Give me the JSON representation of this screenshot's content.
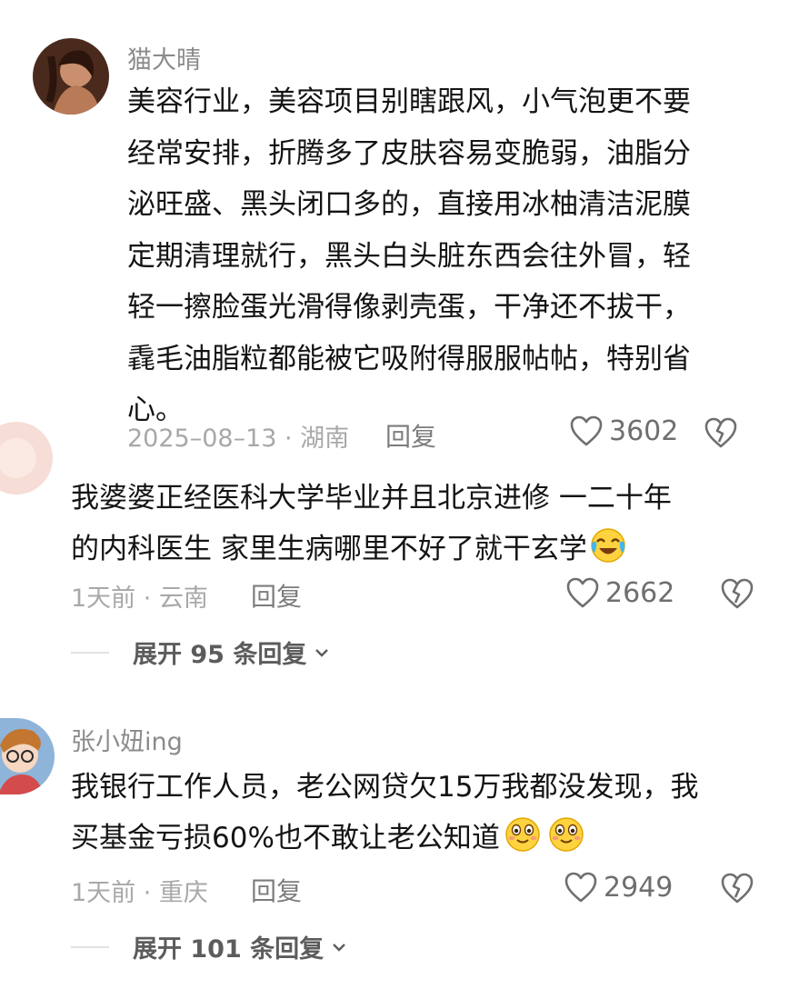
{
  "comments": [
    {
      "username": "猫大晴",
      "lines": [
        "美容行业，美容项目别瞎跟风，小气泡更不要",
        "经常安排，折腾多了皮肤容易变脆弱，油脂分",
        "泌旺盛、黑头闭口多的，直接用冰柚清洁泥膜",
        "定期清理就行，黑头白头脏东西会往外冒，轻",
        "轻一擦脸蛋光滑得像剥壳蛋，干净还不拔干，",
        "毳毛油脂粒都能被它吸附得服服帖帖，特别省",
        "心。"
      ],
      "meta": "2025–08–13 · 湖南",
      "reply_label": "回复",
      "likes": "3602"
    },
    {
      "username": "",
      "lines": [
        "我婆婆正经医科大学毕业并且北京进修 一二十年",
        "的内科医生 家里生病哪里不好了就干玄学"
      ],
      "emoji": [
        "crying-laugh-emoji"
      ],
      "meta": "1天前 · 云南",
      "reply_label": "回复",
      "likes": "2662",
      "expand_label": "展开 95 条回复"
    },
    {
      "username": "张小妞ing",
      "lines": [
        "我银行工作人员，老公网贷欠15万我都没发现，我",
        "买基金亏损60%也不敢让老公知道"
      ],
      "emoji": [
        "smile-emoji",
        "smile-emoji"
      ],
      "meta": "1天前 · 重庆",
      "reply_label": "回复",
      "likes": "2949",
      "expand_label": "展开 101 条回复"
    }
  ],
  "icons": {
    "like": "heart-outline-icon",
    "dislike": "broken-heart-icon",
    "expand": "chevron-down-icon"
  },
  "colors": {
    "text": "#141414",
    "username": "#8b8b8b",
    "meta": "#a8a8a8",
    "icon": "#6f6f6f"
  }
}
